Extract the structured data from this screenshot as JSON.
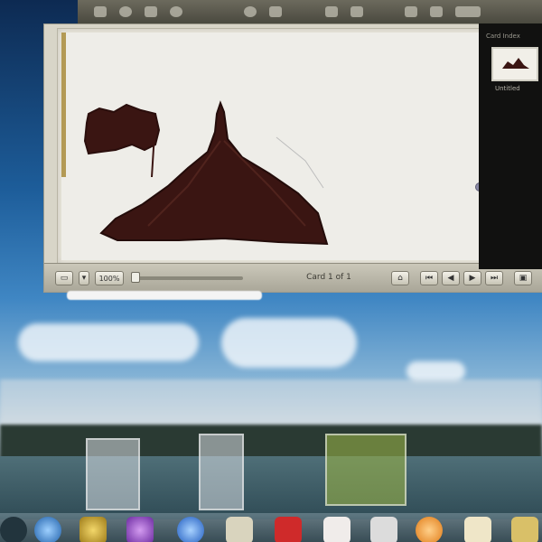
{
  "window": {
    "zoom_value": "100%",
    "card_readout": "Card 1 of 1"
  },
  "side_panel": {
    "title": "Card Index",
    "thumb_label": "Untitled"
  },
  "controls": {
    "home_icon": "home-icon",
    "first_icon": "first-card-icon",
    "prev_icon": "prev-card-icon",
    "next_icon": "next-card-icon",
    "last_icon": "last-card-icon",
    "view_icon": "view-icon"
  },
  "colors": {
    "drawing_fill": "#3a1512",
    "canvas_bg": "#eeede8",
    "panel_bg": "#111110"
  }
}
